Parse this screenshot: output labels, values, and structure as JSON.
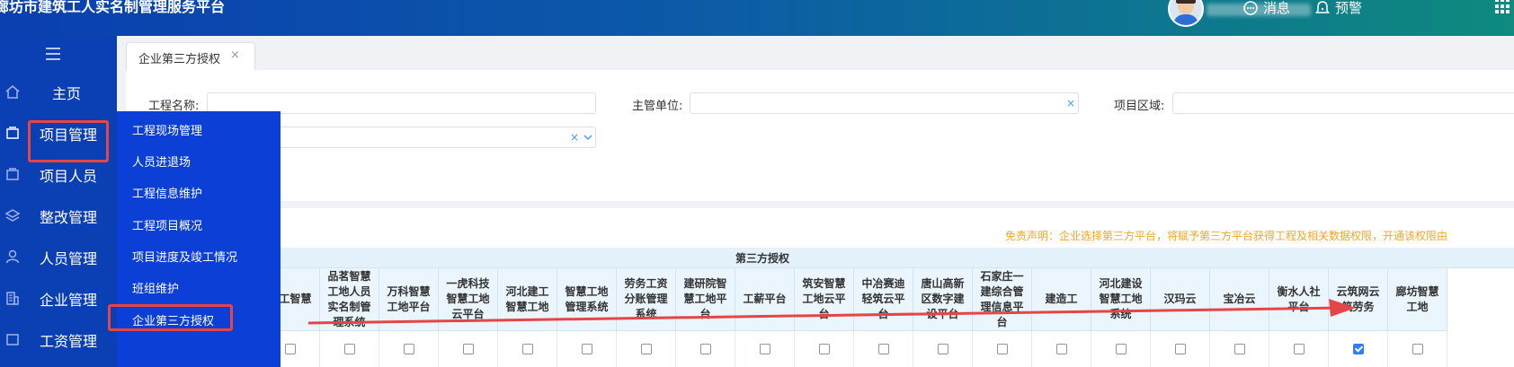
{
  "header": {
    "title": "廊坊市建筑工人实名制管理服务平台",
    "messages_label": "消息",
    "alerts_label": "预警",
    "icons": [
      "avatar",
      "message-icon",
      "bell-icon",
      "grid-icon"
    ]
  },
  "sidebar": {
    "items": [
      {
        "label": "主页",
        "icon": "home-icon"
      },
      {
        "label": "项目管理",
        "icon": "project-icon"
      },
      {
        "label": "项目人员",
        "icon": "people-icon"
      },
      {
        "label": "整改管理",
        "icon": "layers-icon"
      },
      {
        "label": "人员管理",
        "icon": "user-icon"
      },
      {
        "label": "企业管理",
        "icon": "building-icon"
      },
      {
        "label": "工资管理",
        "icon": "wage-icon"
      }
    ]
  },
  "submenu": {
    "items": [
      {
        "label": "工程现场管理"
      },
      {
        "label": "人员进退场"
      },
      {
        "label": "工程信息维护"
      },
      {
        "label": "工程项目概况"
      },
      {
        "label": "项目进度及竣工情况"
      },
      {
        "label": "班组维护"
      },
      {
        "label": "企业第三方授权"
      }
    ]
  },
  "tabs": [
    {
      "label": "企业第三方授权",
      "close": "×"
    }
  ],
  "form": {
    "project_name_label": "工程名称:",
    "authority_label": "主管单位:",
    "region_label": "项目区域:",
    "clear_mark": "×"
  },
  "table": {
    "disclaimer": "免责声明：企业选择第三方平台，将赋予第三方平台获得工程及相关数据权限，开通该权限由",
    "group_title": "第三方授权",
    "columns": [
      {
        "label": "天工智慧",
        "checked": false
      },
      {
        "label": "品茗智慧工地人员实名制管理系统",
        "checked": false
      },
      {
        "label": "万科智慧工地平台",
        "checked": false
      },
      {
        "label": "一虎科技智慧工地云平台",
        "checked": false
      },
      {
        "label": "河北建工智慧工地",
        "checked": false
      },
      {
        "label": "智慧工地管理系统",
        "checked": false
      },
      {
        "label": "劳务工资分账管理系统",
        "checked": false
      },
      {
        "label": "建研院智慧工地平台",
        "checked": false
      },
      {
        "label": "工薪平台",
        "checked": false
      },
      {
        "label": "筑安智慧工地云平台",
        "checked": false
      },
      {
        "label": "中冶赛迪轻筑云平台",
        "checked": false
      },
      {
        "label": "唐山高新区数字建设平台",
        "checked": false
      },
      {
        "label": "石家庄一建综合管理信息平台",
        "checked": false
      },
      {
        "label": "建造工",
        "checked": false
      },
      {
        "label": "河北建设智慧工地系统",
        "checked": false
      },
      {
        "label": "汉玛云",
        "checked": false
      },
      {
        "label": "宝冶云",
        "checked": false
      },
      {
        "label": "衡水人社平台",
        "checked": false
      },
      {
        "label": "云筑网云筑劳务",
        "checked": true
      },
      {
        "label": "廊坊智慧工地",
        "checked": false
      }
    ]
  },
  "annotation": {
    "color": "#e64545"
  }
}
